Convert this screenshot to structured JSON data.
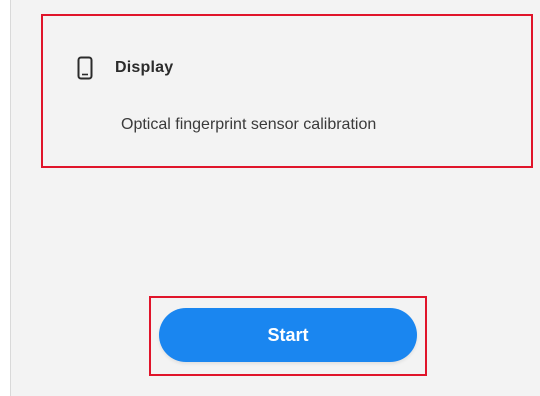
{
  "card": {
    "icon": "phone-icon",
    "title": "Display",
    "description": "Optical fingerprint sensor calibration"
  },
  "start_button": {
    "label": "Start"
  },
  "colors": {
    "accent": "#1a86f0",
    "highlight": "#e0142a",
    "background": "#f3f3f3"
  }
}
